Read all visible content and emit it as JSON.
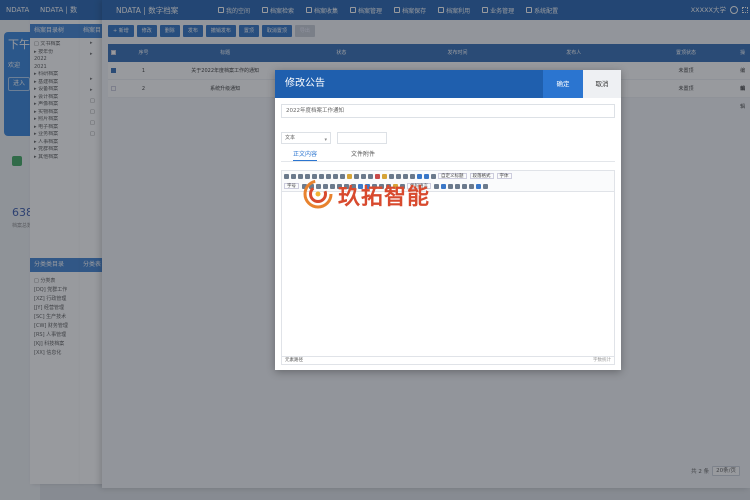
{
  "bg_home": {
    "title": "NDATA",
    "card_title": "下午",
    "card_sub": "欢迎",
    "card_btn": "进入",
    "stat_number": "638",
    "stat_caption": "档案总数"
  },
  "bg_panel2": {
    "title": "NDATA | 数",
    "tree_head": "档案目录树",
    "tree": [
      "□ 文书档案",
      "  ▸ 按年份",
      "    2022",
      "    2021",
      "  ▸ 科研档案",
      "  ▸ 基建档案",
      "  ▸ 设备档案",
      "  ▸ 会计档案",
      "  ▸ 声像档案",
      "  ▸ 实物档案",
      "  ▸ 照片档案",
      "  ▸ 电子档案",
      "  ▸ 业务档案",
      "  ▸ 人事档案",
      "  ▸ 党群档案",
      "  ▸ 其他档案"
    ],
    "class_head": "分类类目录",
    "class_tree": [
      "□ 分类表",
      "  [DQ] 党群工作",
      "  [XZ] 行政管理",
      "  [JY] 经营管理",
      "  [SC] 生产技术",
      "  [CW] 财务管理",
      "  [RS] 人事管理",
      "  [KJ] 科技档案",
      "  [XX] 信息化"
    ]
  },
  "bg_panel3": {
    "tree_head": "档案目",
    "class_head": "分类表"
  },
  "app": {
    "logo": "NDATA | 数字档案",
    "nav": [
      "我的空间",
      "档案检索",
      "档案收集",
      "档案管理",
      "档案保存",
      "档案利用",
      "业务管理",
      "系统配置"
    ],
    "user": "XXXXX大学",
    "toolbar": [
      "+ 新增",
      "修改",
      "删除",
      "发布",
      "撤销发布",
      "置顶",
      "取消置顶",
      "导出"
    ],
    "columns": [
      "",
      "序号",
      "标题",
      "状态",
      "发布时间",
      "发布人",
      "置顶状态",
      "操作"
    ],
    "rows": [
      {
        "index": "1",
        "title": "关于2022年度档案工作的通知",
        "status": "",
        "time": "",
        "author": "",
        "pin": "未置顶",
        "op": "编辑"
      },
      {
        "index": "2",
        "title": "系统升级通知",
        "status": "",
        "time": "",
        "author": "",
        "pin": "未置顶",
        "op": "编辑"
      }
    ],
    "pager": {
      "info": "共 2 条",
      "size": "20条/页"
    }
  },
  "modal": {
    "title": "修改公告",
    "ok": "确定",
    "cancel": "取消",
    "title_value": "2022年度档案工作通知",
    "select_value": "文本",
    "tabs": [
      "正文内容",
      "文件附件"
    ],
    "toolbar_labels": {
      "font_size": "字号",
      "custom_label": "自定义标题",
      "paragraph": "段落格式",
      "font": "字体",
      "code": "代码语言"
    },
    "status_left": "元素路径",
    "status_right": "字数统计"
  },
  "watermark": {
    "text": "玖拓智能"
  },
  "colors": {
    "primary": "#1f5fae",
    "accent": "#2b75d0",
    "watermark": "#d84a2e"
  }
}
